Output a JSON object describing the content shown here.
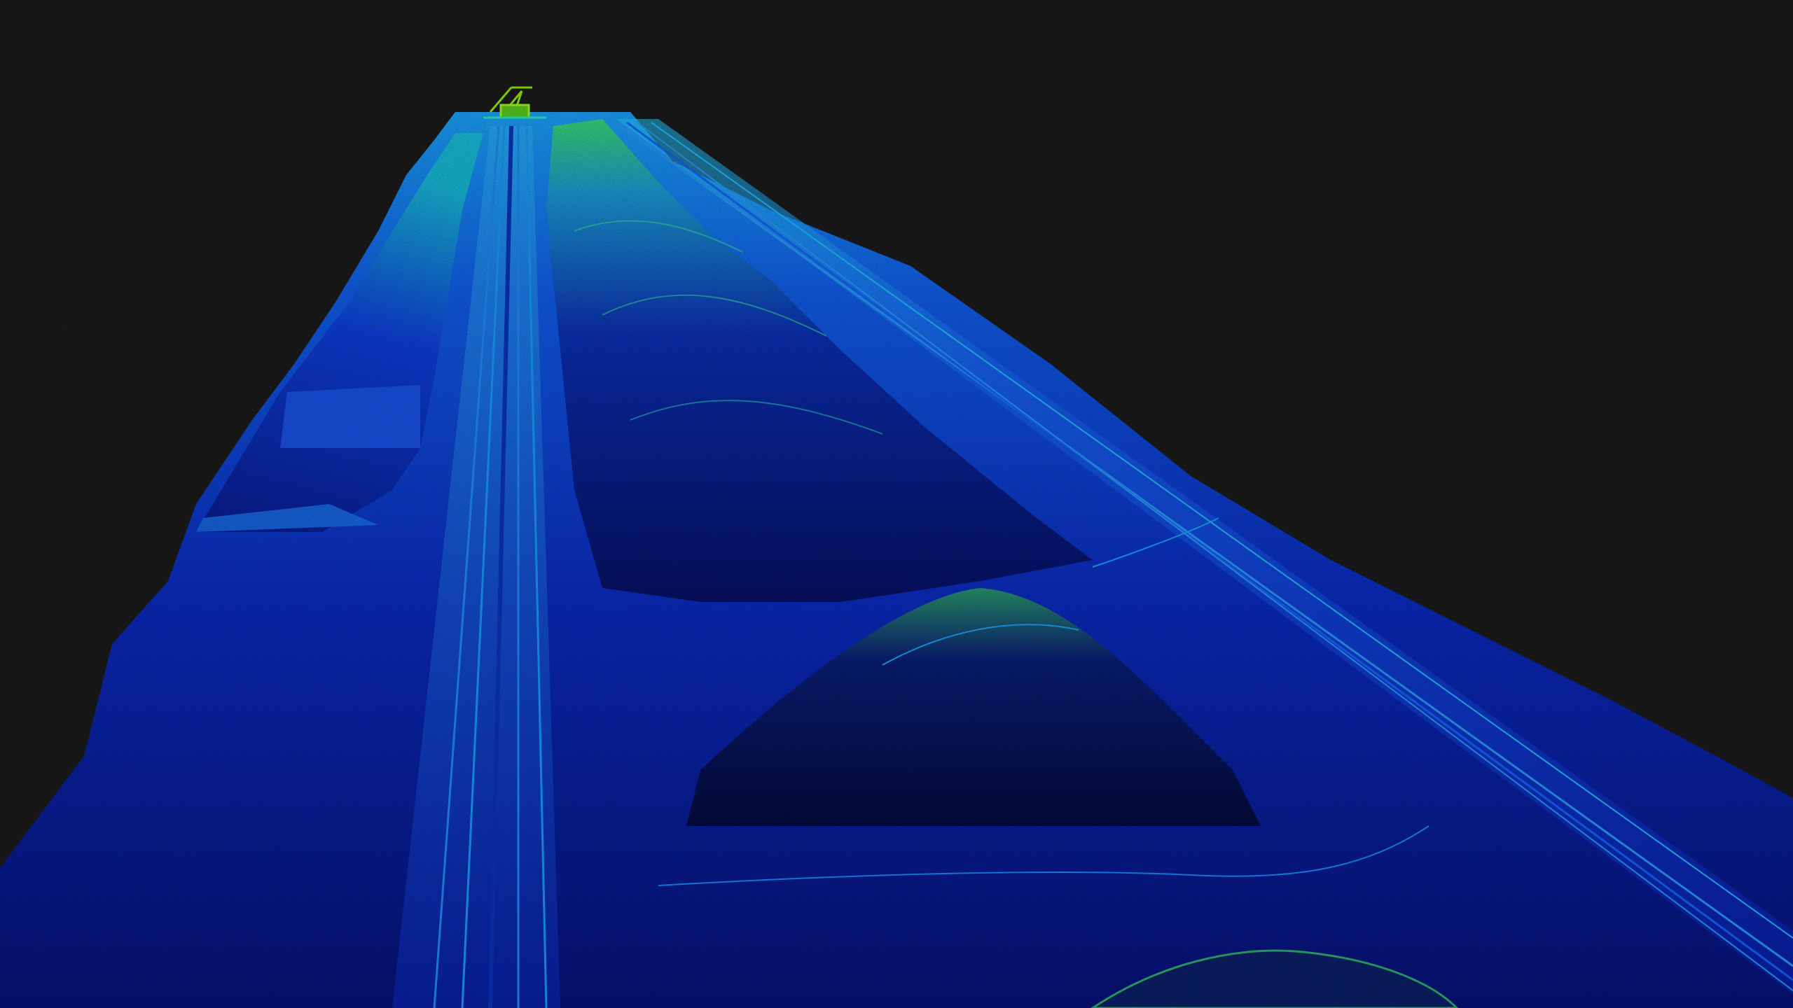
{
  "viewer": {
    "background_color": "#1b1b1b"
  },
  "colormap": {
    "name": "height-jet",
    "low": "#0a1a8c",
    "mid_low": "#0f3fd6",
    "mid": "#1e8cff",
    "mid_high": "#22d6b8",
    "high": "#a8f000",
    "peak": "#c8ff20"
  },
  "scene": {
    "subject": "lidar-point-cloud",
    "features": [
      "stockpile-mounds",
      "parallel-rail-tracks",
      "stacker-reclaimer-machine"
    ]
  }
}
